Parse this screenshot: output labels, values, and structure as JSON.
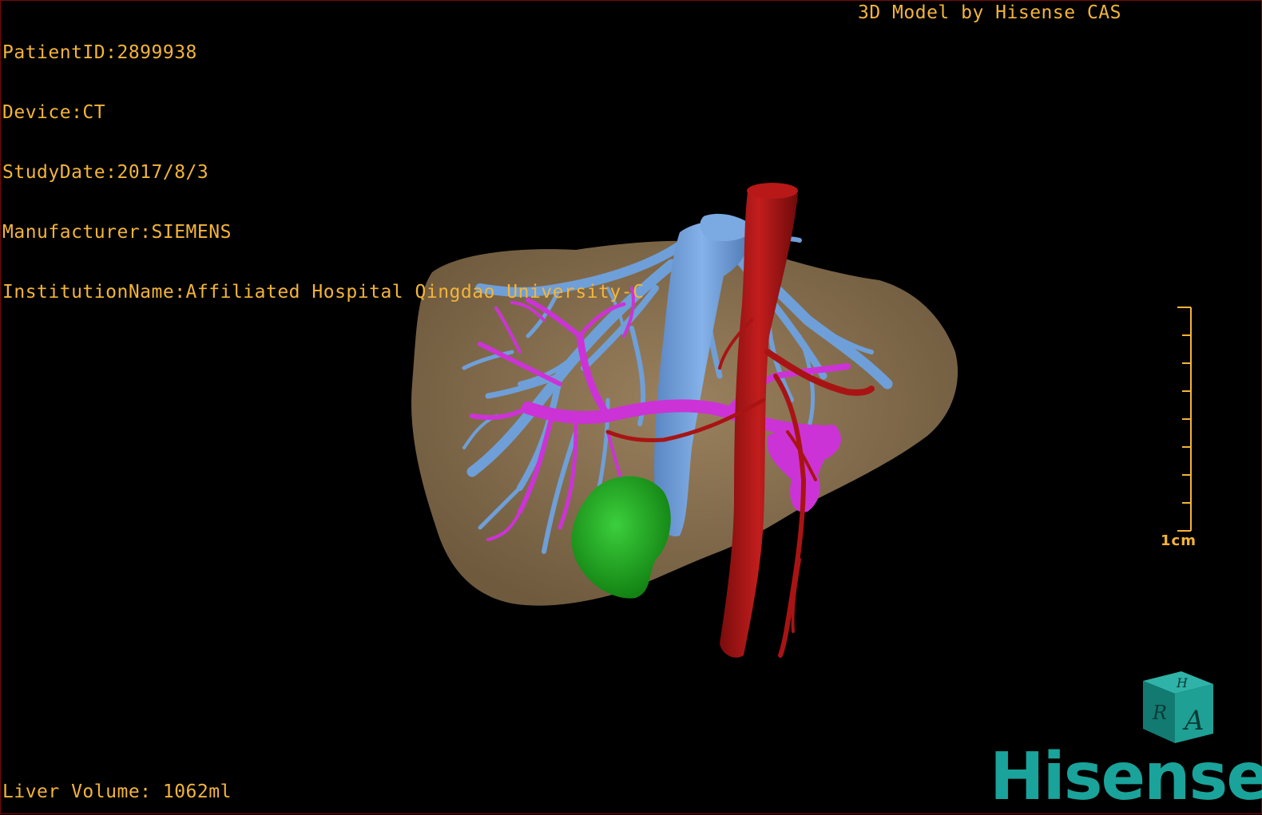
{
  "patient_info": {
    "patient_id": "PatientID:2899938",
    "device": "Device:CT",
    "study_date": "StudyDate:2017/8/3",
    "manufacturer": "Manufacturer:SIEMENS",
    "institution": "InstitutionName:Affiliated Hospital Qingdao University-C"
  },
  "credit": "3D Model by Hisense CAS",
  "liver_volume": "Liver Volume: 1062ml",
  "scale_bar": {
    "label": "1cm"
  },
  "brand": "Hisense",
  "orientation_cube": {
    "front": "A",
    "top": "H",
    "side": "R"
  },
  "colors": {
    "overlay_text": "#f3b43a",
    "liver": "#8f7756",
    "hepatic_vein": "#6f9fd8",
    "portal_vein": "#cc33d6",
    "artery": "#a81414",
    "tumor": "#1fa31f",
    "brand": "#1aa39a"
  }
}
